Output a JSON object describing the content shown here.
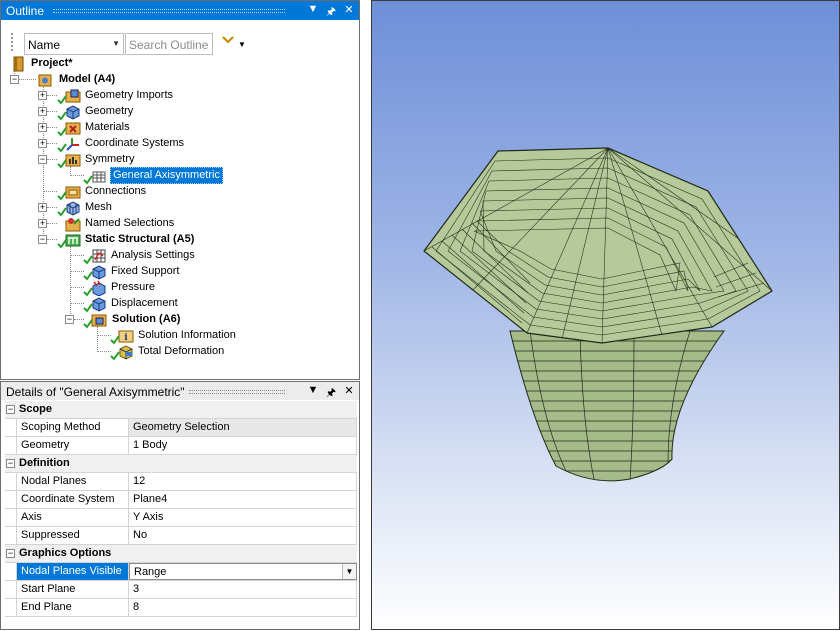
{
  "outline": {
    "title": "Outline",
    "filter_select": "Name",
    "search_placeholder": "Search Outline",
    "tree": {
      "project": "Project*",
      "model": "Model (A4)",
      "geometry_imports": "Geometry Imports",
      "geometry": "Geometry",
      "materials": "Materials",
      "coordinate_systems": "Coordinate Systems",
      "symmetry": "Symmetry",
      "general_axisymmetric": "General Axisymmetric",
      "connections": "Connections",
      "mesh": "Mesh",
      "named_selections": "Named Selections",
      "static_structural": "Static Structural (A5)",
      "analysis_settings": "Analysis Settings",
      "fixed_support": "Fixed Support",
      "pressure": "Pressure",
      "displacement": "Displacement",
      "solution": "Solution (A6)",
      "solution_information": "Solution Information",
      "total_deformation": "Total Deformation"
    }
  },
  "details": {
    "title": "Details of \"General Axisymmetric\"",
    "scope": {
      "header": "Scope",
      "scoping_method_label": "Scoping Method",
      "scoping_method_value": "Geometry Selection",
      "geometry_label": "Geometry",
      "geometry_value": "1 Body"
    },
    "definition": {
      "header": "Definition",
      "nodal_planes_label": "Nodal Planes",
      "nodal_planes_value": "12",
      "coordinate_system_label": "Coordinate System",
      "coordinate_system_value": "Plane4",
      "axis_label": "Axis",
      "axis_value": "Y Axis",
      "suppressed_label": "Suppressed",
      "suppressed_value": "No"
    },
    "graphics": {
      "header": "Graphics Options",
      "nodal_planes_visible_label": "Nodal Planes Visible",
      "nodal_planes_visible_value": "Range",
      "start_plane_label": "Start Plane",
      "start_plane_value": "3",
      "end_plane_label": "End Plane",
      "end_plane_value": "8"
    }
  },
  "colors": {
    "title_bar": "#0078d7",
    "selection": "#0078d7",
    "model_face": "#b5c99a",
    "model_edge": "#1f2a14",
    "check_green": "#2e9e2e"
  },
  "icons": {
    "title_buttons": [
      "dropdown-icon",
      "pin-icon",
      "close-icon"
    ]
  }
}
